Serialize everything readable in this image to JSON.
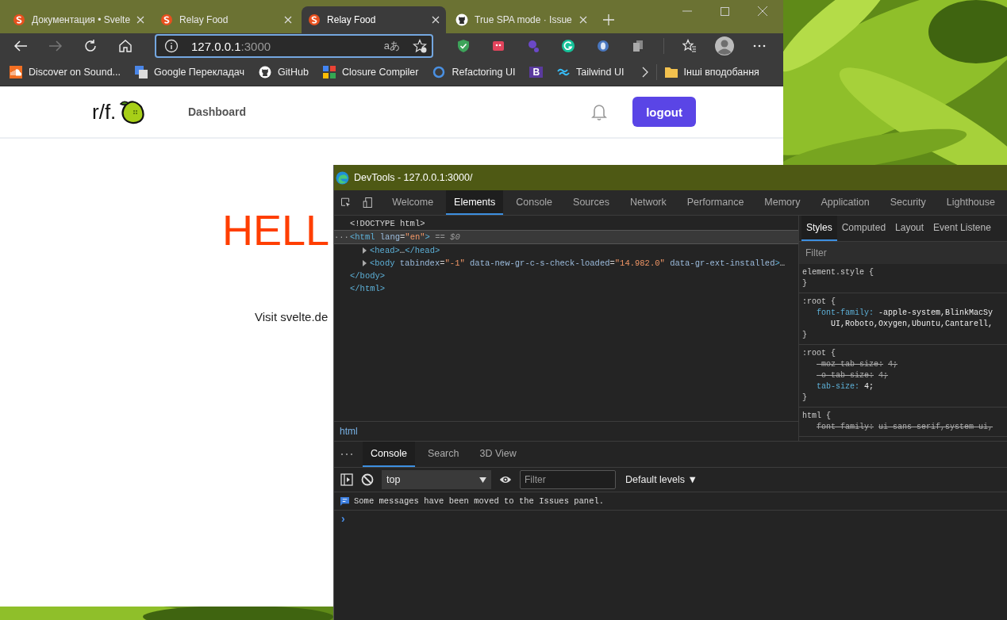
{
  "browser": {
    "tabs": [
      {
        "title": "Документация • Svelte",
        "selected": false
      },
      {
        "title": "Relay Food",
        "selected": false
      },
      {
        "title": "Relay Food",
        "selected": true
      },
      {
        "title": "True SPA mode · Issue",
        "selected": false
      }
    ],
    "address": {
      "host": "127.0.0.1",
      "port": ":3000",
      "read_aloud": "aあ"
    },
    "bookmarks": [
      {
        "label": "Discover on Sound...",
        "kind": "soundcloud"
      },
      {
        "label": "Google Перекладач",
        "kind": "translate"
      },
      {
        "label": "GitHub",
        "kind": "github"
      },
      {
        "label": "Closure Compiler",
        "kind": "closure"
      },
      {
        "label": "Refactoring UI",
        "kind": "ring"
      },
      {
        "label": "B",
        "kind": "letter"
      },
      {
        "label": "Tailwind UI",
        "kind": "tailwind"
      }
    ],
    "other_favorites": "Інші вподобання"
  },
  "page": {
    "logo": "r/f.",
    "nav": [
      {
        "label": "Dashboard"
      }
    ],
    "logout": "logout",
    "heading": "HELL",
    "visit": "Visit svelte.de"
  },
  "devtools": {
    "title": "DevTools - 127.0.0.1:3000/",
    "tabs": [
      {
        "label": "Welcome",
        "selected": false
      },
      {
        "label": "Elements",
        "selected": true
      },
      {
        "label": "Console",
        "selected": false
      },
      {
        "label": "Sources",
        "selected": false
      },
      {
        "label": "Network",
        "selected": false
      },
      {
        "label": "Performance",
        "selected": false
      },
      {
        "label": "Memory",
        "selected": false
      },
      {
        "label": "Application",
        "selected": false
      },
      {
        "label": "Security",
        "selected": false
      },
      {
        "label": "Lighthouse",
        "selected": false
      }
    ],
    "dom": [
      {
        "selected": false,
        "tokens": [
          {
            "kind": "plain",
            "t": "<!DOCTYPE html>"
          }
        ]
      },
      {
        "selected": true,
        "gutter": "···",
        "tokens": [
          {
            "kind": "tag",
            "t": "<html"
          },
          {
            "kind": "attr",
            "t": " lang"
          },
          {
            "kind": "plain",
            "t": "="
          },
          {
            "kind": "val",
            "t": "\"en\""
          },
          {
            "kind": "tag",
            "t": ">"
          },
          {
            "kind": "dim",
            "t": " == "
          },
          {
            "kind": "dimi",
            "t": "$0"
          }
        ],
        "children": [
          {
            "selected": false,
            "expanded": false,
            "tokens": [
              {
                "kind": "tag",
                "t": "<head>"
              },
              {
                "kind": "plain",
                "t": "…"
              },
              {
                "kind": "tag",
                "t": "</head>"
              }
            ]
          },
          {
            "selected": false,
            "expanded": false,
            "tokens": [
              {
                "kind": "tag",
                "t": "<body"
              },
              {
                "kind": "attr",
                "t": " tabindex"
              },
              {
                "kind": "plain",
                "t": "="
              },
              {
                "kind": "val",
                "t": "\"-1\""
              },
              {
                "kind": "attr",
                "t": " data-new-gr-c-s-check-loaded"
              },
              {
                "kind": "plain",
                "t": "="
              },
              {
                "kind": "val",
                "t": "\"14.982.0\""
              },
              {
                "kind": "attr",
                "t": " data-gr-ext-installed"
              },
              {
                "kind": "tag",
                "t": ">"
              },
              {
                "kind": "plain",
                "t": "…"
              }
            ]
          }
        ]
      },
      {
        "selected": false,
        "tokens": [
          {
            "kind": "tag",
            "t": "</body>"
          }
        ]
      },
      {
        "selected": false,
        "tokens": [
          {
            "kind": "tag",
            "t": "</html>"
          }
        ]
      }
    ],
    "breadcrumb": "html",
    "side_tabs": [
      {
        "label": "Styles",
        "selected": true
      },
      {
        "label": "Computed",
        "selected": false
      },
      {
        "label": "Layout",
        "selected": false
      },
      {
        "label": "Event Listene",
        "selected": false
      }
    ],
    "styles_filter": {
      "placeholder": "Filter"
    },
    "rules": [
      {
        "lines": [
          {
            "kind": "selector",
            "text": "element.style {"
          },
          {
            "kind": "close",
            "text": "}"
          }
        ]
      },
      {
        "lines": [
          {
            "kind": "selector",
            "text": ":root {"
          },
          {
            "kind": "decl",
            "prop": "font-family:",
            "value": "-apple-system,BlinkMacSy",
            "struck": false
          },
          {
            "kind": "cont",
            "text": "UI,Roboto,Oxygen,Ubuntu,Cantarell,"
          },
          {
            "kind": "close",
            "text": "}"
          }
        ]
      },
      {
        "lines": [
          {
            "kind": "selector",
            "text": ":root {"
          },
          {
            "kind": "decl",
            "prop": "-moz-tab-size:",
            "value": "4;",
            "struck": true
          },
          {
            "kind": "decl",
            "prop": "-o-tab-size:",
            "value": "4;",
            "struck": true
          },
          {
            "kind": "decl",
            "prop": "tab-size:",
            "value": "4;",
            "struck": false
          },
          {
            "kind": "close",
            "text": "}"
          }
        ]
      },
      {
        "lines": [
          {
            "kind": "selector",
            "text": "html {"
          },
          {
            "kind": "decl",
            "prop": "font-family:",
            "value": "ui-sans-serif,system-ui,",
            "struck": true
          }
        ]
      }
    ],
    "drawer_tabs": [
      {
        "label": "Console",
        "selected": true
      },
      {
        "label": "Search",
        "selected": false
      },
      {
        "label": "3D View",
        "selected": false
      }
    ],
    "context": "top",
    "console_filter": {
      "placeholder": "Filter"
    },
    "levels": "Default levels ▼",
    "messages": [
      {
        "kind": "info",
        "text": "Some messages have been moved to the Issues panel."
      }
    ],
    "prompt": "›"
  }
}
